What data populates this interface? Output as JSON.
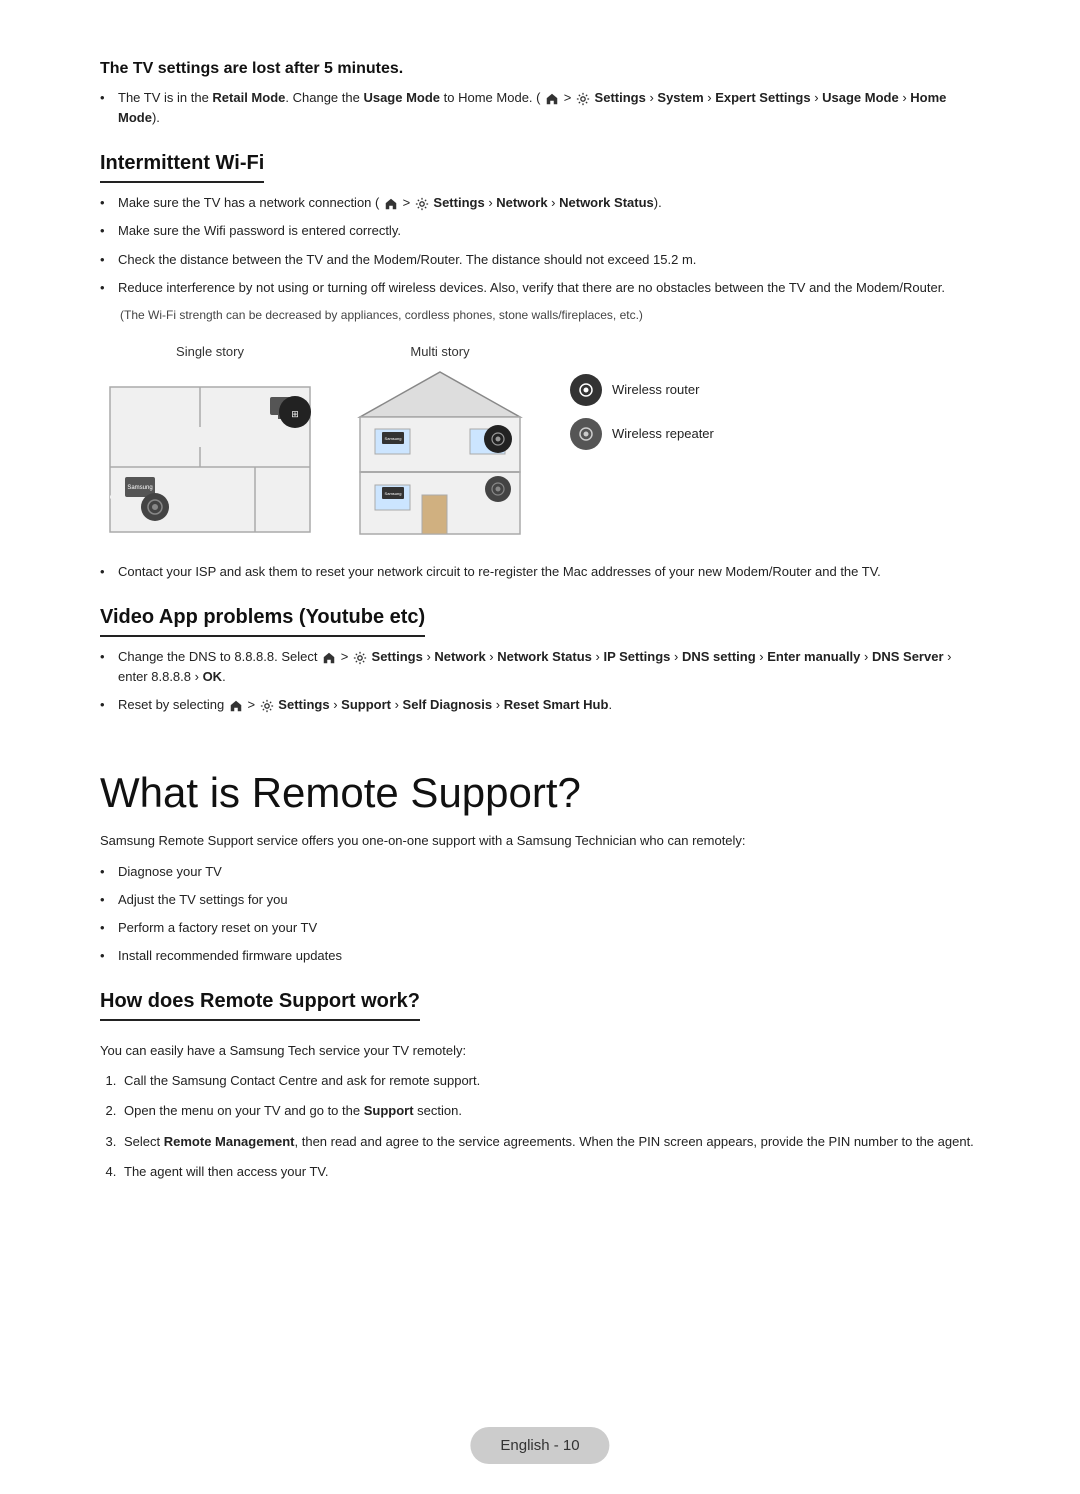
{
  "sections": {
    "tv_settings_title": "The TV settings are lost after 5 minutes.",
    "tv_settings_bullets": [
      "The TV is in the Retail Mode. Change the Usage Mode to Home Mode. (Home > Settings > System > Expert Settings > Usage Mode > Home Mode)."
    ],
    "intermittent_title": "Intermittent Wi-Fi",
    "intermittent_bullets": [
      "Make sure the TV has a network connection (Home > Settings > Network > Network Status).",
      "Make sure the Wifi password is entered correctly.",
      "Check the distance between the TV and the Modem/Router. The distance should not exceed 15.2 m.",
      "Reduce interference by not using or turning off wireless devices. Also, verify that there are no obstacles between the TV and the Modem/Router."
    ],
    "wifi_note": "(The Wi-Fi strength can be decreased by appliances, cordless phones, stone walls/fireplaces, etc.)",
    "diagram_single_label": "Single story",
    "diagram_multi_label": "Multi story",
    "wireless_router_label": "Wireless router",
    "wireless_repeater_label": "Wireless repeater",
    "contact_bullet": "Contact your ISP and ask them to reset your network circuit to re-register the Mac addresses of your new Modem/Router and the TV.",
    "video_app_title": "Video App problems (Youtube etc)",
    "video_app_bullets": [
      "Change the DNS to 8.8.8.8. Select Home > Settings > Network > Network Status > IP Settings > DNS setting > Enter manually > DNS Server > enter 8.8.8.8 > OK.",
      "Reset by selecting Home > Settings > Support > Self Diagnosis > Reset Smart Hub."
    ],
    "main_title": "What is Remote Support?",
    "remote_support_intro": "Samsung Remote Support service offers you one-on-one support with a Samsung Technician who can remotely:",
    "remote_support_bullets": [
      "Diagnose your TV",
      "Adjust the TV settings for you",
      "Perform a factory reset on your TV",
      "Install recommended firmware updates"
    ],
    "how_title": "How does Remote Support work?",
    "how_intro": "You can easily have a Samsung Tech service your TV remotely:",
    "how_steps": [
      "Call the Samsung Contact Centre and ask for remote support.",
      "Open the menu on your TV and go to the Support section.",
      "Select Remote Management, then read and agree to the service agreements. When the PIN screen appears, provide the PIN number to the agent.",
      "The agent will then access your TV."
    ]
  },
  "footer": {
    "page_label": "English - 10"
  }
}
